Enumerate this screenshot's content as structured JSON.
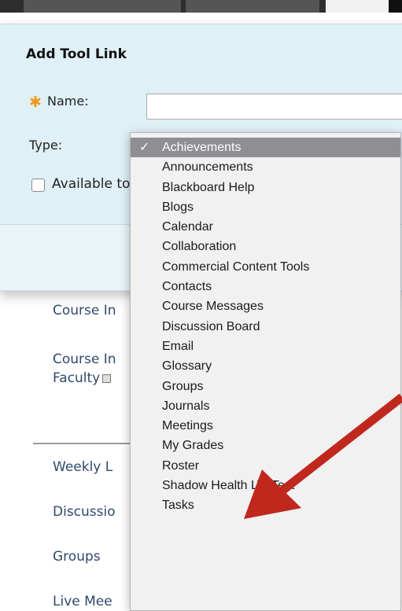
{
  "dialog": {
    "title": "Add Tool Link",
    "name_label": "Name:",
    "name_value": "",
    "type_label": "Type:",
    "available_label": "Available to Users",
    "required_icon": "asterisk-icon"
  },
  "dropdown": {
    "selected": "Achievements",
    "check_glyph": "✓",
    "items": [
      "Achievements",
      "Announcements",
      "Blackboard Help",
      "Blogs",
      "Calendar",
      "Collaboration",
      "Commercial Content Tools",
      "Contacts",
      "Course Messages",
      "Discussion Board",
      "Email",
      "Glossary",
      "Groups",
      "Journals",
      "Meetings",
      "My Grades",
      "Roster",
      "Shadow Health LTI Test",
      "Tasks"
    ]
  },
  "course_menu": {
    "items": [
      "Course In",
      "Course In",
      "Faculty",
      "Weekly L",
      "Discussio",
      "Groups",
      "Live Mee"
    ]
  },
  "colors": {
    "panel_bg": "#dff0f6",
    "selected_bg": "#8e8e93",
    "arrow": "#c0281e",
    "link": "#2f4a6b",
    "required": "#f09a1a"
  }
}
